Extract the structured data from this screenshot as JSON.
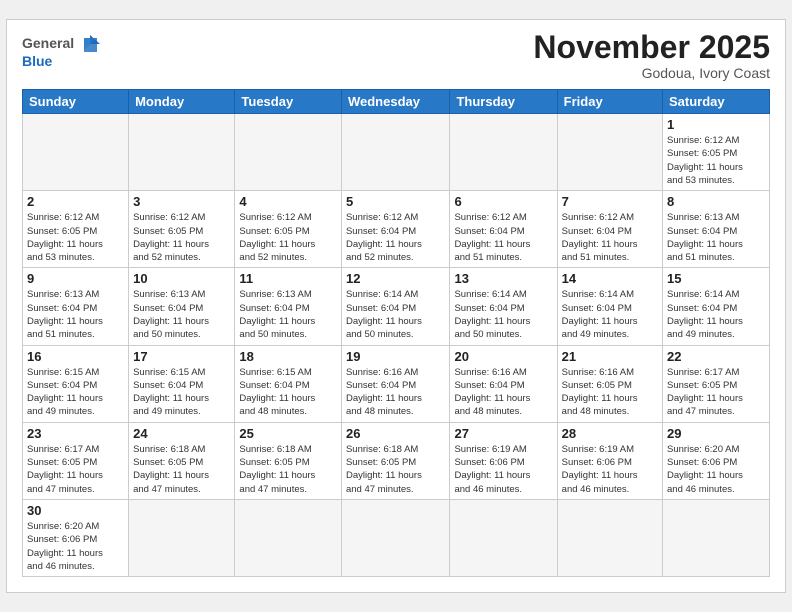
{
  "header": {
    "logo_general": "General",
    "logo_blue": "Blue",
    "month_title": "November 2025",
    "location": "Godoua, Ivory Coast"
  },
  "days_of_week": [
    "Sunday",
    "Monday",
    "Tuesday",
    "Wednesday",
    "Thursday",
    "Friday",
    "Saturday"
  ],
  "weeks": [
    [
      {
        "day": "",
        "info": ""
      },
      {
        "day": "",
        "info": ""
      },
      {
        "day": "",
        "info": ""
      },
      {
        "day": "",
        "info": ""
      },
      {
        "day": "",
        "info": ""
      },
      {
        "day": "",
        "info": ""
      },
      {
        "day": "1",
        "info": "Sunrise: 6:12 AM\nSunset: 6:05 PM\nDaylight: 11 hours\nand 53 minutes."
      }
    ],
    [
      {
        "day": "2",
        "info": "Sunrise: 6:12 AM\nSunset: 6:05 PM\nDaylight: 11 hours\nand 53 minutes."
      },
      {
        "day": "3",
        "info": "Sunrise: 6:12 AM\nSunset: 6:05 PM\nDaylight: 11 hours\nand 52 minutes."
      },
      {
        "day": "4",
        "info": "Sunrise: 6:12 AM\nSunset: 6:05 PM\nDaylight: 11 hours\nand 52 minutes."
      },
      {
        "day": "5",
        "info": "Sunrise: 6:12 AM\nSunset: 6:04 PM\nDaylight: 11 hours\nand 52 minutes."
      },
      {
        "day": "6",
        "info": "Sunrise: 6:12 AM\nSunset: 6:04 PM\nDaylight: 11 hours\nand 51 minutes."
      },
      {
        "day": "7",
        "info": "Sunrise: 6:12 AM\nSunset: 6:04 PM\nDaylight: 11 hours\nand 51 minutes."
      },
      {
        "day": "8",
        "info": "Sunrise: 6:13 AM\nSunset: 6:04 PM\nDaylight: 11 hours\nand 51 minutes."
      }
    ],
    [
      {
        "day": "9",
        "info": "Sunrise: 6:13 AM\nSunset: 6:04 PM\nDaylight: 11 hours\nand 51 minutes."
      },
      {
        "day": "10",
        "info": "Sunrise: 6:13 AM\nSunset: 6:04 PM\nDaylight: 11 hours\nand 50 minutes."
      },
      {
        "day": "11",
        "info": "Sunrise: 6:13 AM\nSunset: 6:04 PM\nDaylight: 11 hours\nand 50 minutes."
      },
      {
        "day": "12",
        "info": "Sunrise: 6:14 AM\nSunset: 6:04 PM\nDaylight: 11 hours\nand 50 minutes."
      },
      {
        "day": "13",
        "info": "Sunrise: 6:14 AM\nSunset: 6:04 PM\nDaylight: 11 hours\nand 50 minutes."
      },
      {
        "day": "14",
        "info": "Sunrise: 6:14 AM\nSunset: 6:04 PM\nDaylight: 11 hours\nand 49 minutes."
      },
      {
        "day": "15",
        "info": "Sunrise: 6:14 AM\nSunset: 6:04 PM\nDaylight: 11 hours\nand 49 minutes."
      }
    ],
    [
      {
        "day": "16",
        "info": "Sunrise: 6:15 AM\nSunset: 6:04 PM\nDaylight: 11 hours\nand 49 minutes."
      },
      {
        "day": "17",
        "info": "Sunrise: 6:15 AM\nSunset: 6:04 PM\nDaylight: 11 hours\nand 49 minutes."
      },
      {
        "day": "18",
        "info": "Sunrise: 6:15 AM\nSunset: 6:04 PM\nDaylight: 11 hours\nand 48 minutes."
      },
      {
        "day": "19",
        "info": "Sunrise: 6:16 AM\nSunset: 6:04 PM\nDaylight: 11 hours\nand 48 minutes."
      },
      {
        "day": "20",
        "info": "Sunrise: 6:16 AM\nSunset: 6:04 PM\nDaylight: 11 hours\nand 48 minutes."
      },
      {
        "day": "21",
        "info": "Sunrise: 6:16 AM\nSunset: 6:05 PM\nDaylight: 11 hours\nand 48 minutes."
      },
      {
        "day": "22",
        "info": "Sunrise: 6:17 AM\nSunset: 6:05 PM\nDaylight: 11 hours\nand 47 minutes."
      }
    ],
    [
      {
        "day": "23",
        "info": "Sunrise: 6:17 AM\nSunset: 6:05 PM\nDaylight: 11 hours\nand 47 minutes."
      },
      {
        "day": "24",
        "info": "Sunrise: 6:18 AM\nSunset: 6:05 PM\nDaylight: 11 hours\nand 47 minutes."
      },
      {
        "day": "25",
        "info": "Sunrise: 6:18 AM\nSunset: 6:05 PM\nDaylight: 11 hours\nand 47 minutes."
      },
      {
        "day": "26",
        "info": "Sunrise: 6:18 AM\nSunset: 6:05 PM\nDaylight: 11 hours\nand 47 minutes."
      },
      {
        "day": "27",
        "info": "Sunrise: 6:19 AM\nSunset: 6:06 PM\nDaylight: 11 hours\nand 46 minutes."
      },
      {
        "day": "28",
        "info": "Sunrise: 6:19 AM\nSunset: 6:06 PM\nDaylight: 11 hours\nand 46 minutes."
      },
      {
        "day": "29",
        "info": "Sunrise: 6:20 AM\nSunset: 6:06 PM\nDaylight: 11 hours\nand 46 minutes."
      }
    ],
    [
      {
        "day": "30",
        "info": "Sunrise: 6:20 AM\nSunset: 6:06 PM\nDaylight: 11 hours\nand 46 minutes."
      },
      {
        "day": "",
        "info": ""
      },
      {
        "day": "",
        "info": ""
      },
      {
        "day": "",
        "info": ""
      },
      {
        "day": "",
        "info": ""
      },
      {
        "day": "",
        "info": ""
      },
      {
        "day": "",
        "info": ""
      }
    ]
  ]
}
